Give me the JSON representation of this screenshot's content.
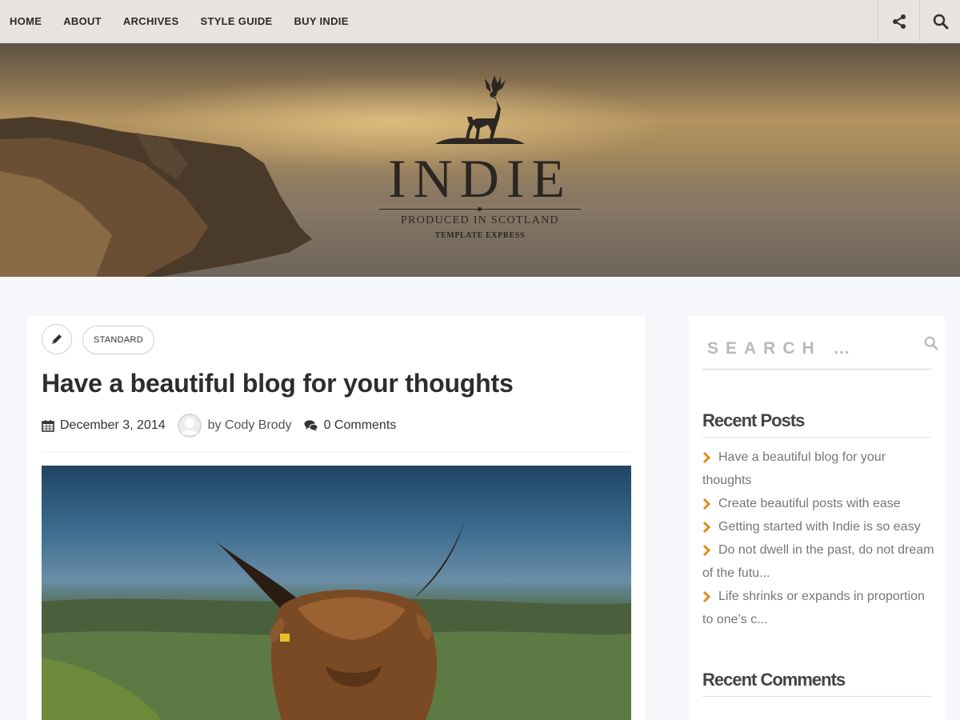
{
  "nav": {
    "items": [
      "HOME",
      "ABOUT",
      "ARCHIVES",
      "STYLE GUIDE",
      "BUY INDIE"
    ],
    "icons": [
      "share-icon",
      "search-icon"
    ]
  },
  "banner": {
    "logo_title": "INDIE",
    "logo_subtitle": "PRODUCED IN SCOTLAND",
    "logo_tagline": "TEMPLATE EXPRESS"
  },
  "post": {
    "format_label": "STANDARD",
    "title": "Have a beautiful blog for your thoughts",
    "date": "December 3, 2014",
    "author": "by Cody Brody",
    "comments": "0 Comments"
  },
  "sidebar": {
    "search_placeholder": "SEARCH …",
    "recent_posts_title": "Recent Posts",
    "recent_posts": [
      "Have a beautiful blog for your thoughts",
      "Create beautiful posts with ease",
      "Getting started with Indie is so easy",
      "Do not dwell in the past, do not dream of the futu...",
      "Life shrinks or expands in proportion to one’s c..."
    ],
    "recent_comments_title": "Recent Comments"
  },
  "colors": {
    "accent": "#e08a1e",
    "nav_bg": "#e6e3e0",
    "page_bg": "#f6f7fb"
  }
}
